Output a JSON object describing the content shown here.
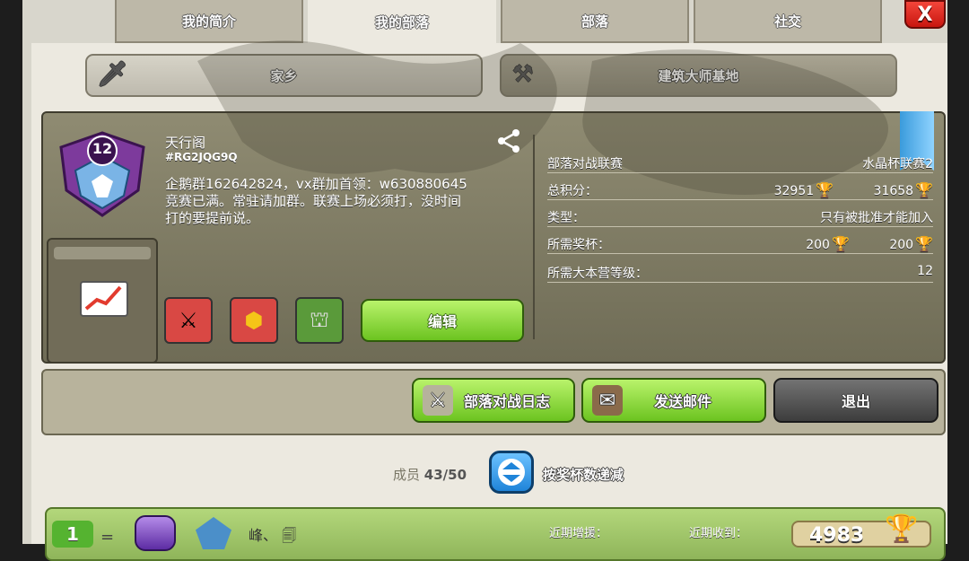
{
  "tabs": [
    "我的简介",
    "我的部落",
    "部落",
    "社交"
  ],
  "close_label": "X",
  "subtabs": {
    "home": "家乡",
    "builder": "建筑大师基地"
  },
  "clan": {
    "level": "12",
    "name": "天行阁",
    "tag": "#RG2JQG9Q",
    "desc_line1": "企鹅群162642824，vx群加首领：w630880645",
    "desc_line2": "竞赛已满。常驻请加群。联赛上场必须打，没时间",
    "desc_line3": "打的要提前说。",
    "edit_label": "编辑"
  },
  "info": {
    "war_league_label": "部落对战联赛",
    "war_league_value": "水晶杯联赛2",
    "points_label": "总积分：",
    "points_home": "32951",
    "points_builder": "31658",
    "type_label": "类型：",
    "type_value": "只有被批准才能加入",
    "req_trophies_label": "所需奖杯：",
    "req_trophies_home": "200",
    "req_trophies_builder": "200",
    "req_th_label": "所需大本营等级：",
    "req_th_value": "12"
  },
  "actions": {
    "war_log": "部落对战日志",
    "send_mail": "发送邮件",
    "leave": "退出"
  },
  "members": {
    "label": "成员",
    "count": "43/50",
    "sort_label": "按奖杯数递减"
  },
  "member_row": {
    "rank": "1",
    "equals": "=",
    "name": "峰、",
    "recent_given": "近期增援：",
    "recent_received": "近期收到：",
    "trophies": "4983"
  },
  "colors": {
    "accent_green": "#6cc320",
    "close_red": "#e0281f",
    "sort_blue": "#1f84d9"
  }
}
